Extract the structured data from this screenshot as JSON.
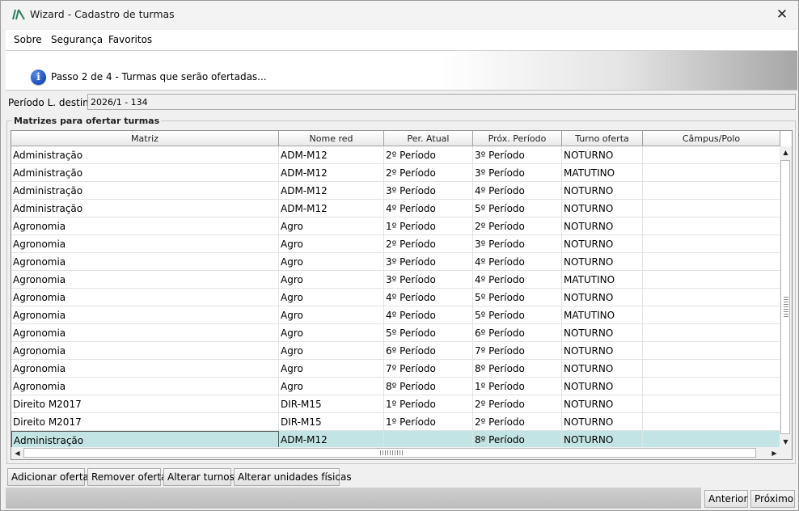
{
  "window": {
    "title": "Wizard - Cadastro de turmas",
    "close_symbol": "✕"
  },
  "menu": {
    "items": [
      "Sobre",
      "Segurança",
      "Favoritos"
    ]
  },
  "wizard": {
    "step_text": "Passo 2 de 4 - Turmas que serão ofertadas...",
    "info_icon_glyph": "i"
  },
  "period": {
    "label": "Período L. destino:",
    "value": "2026/1 - 134"
  },
  "group": {
    "title": "Matrizes para ofertar turmas"
  },
  "table": {
    "columns": [
      "Matriz",
      "Nome red",
      "Per. Atual",
      "Próx. Período",
      "Turno oferta",
      "Câmpus/Polo"
    ],
    "rows": [
      [
        "Administração",
        "ADM-M12",
        "2º Período",
        "3º Período",
        "NOTURNO",
        ""
      ],
      [
        "Administração",
        "ADM-M12",
        "2º Período",
        "3º Período",
        "MATUTINO",
        ""
      ],
      [
        "Administração",
        "ADM-M12",
        "3º Período",
        "4º Período",
        "NOTURNO",
        ""
      ],
      [
        "Administração",
        "ADM-M12",
        "4º Período",
        "5º Período",
        "NOTURNO",
        ""
      ],
      [
        "Agronomia",
        "Agro",
        "1º Período",
        "2º Período",
        "NOTURNO",
        ""
      ],
      [
        "Agronomia",
        "Agro",
        "2º Período",
        "3º Período",
        "NOTURNO",
        ""
      ],
      [
        "Agronomia",
        "Agro",
        "3º Período",
        "4º Período",
        "NOTURNO",
        ""
      ],
      [
        "Agronomia",
        "Agro",
        "3º Período",
        "4º Período",
        "MATUTINO",
        ""
      ],
      [
        "Agronomia",
        "Agro",
        "4º Período",
        "5º Período",
        "NOTURNO",
        ""
      ],
      [
        "Agronomia",
        "Agro",
        "4º Período",
        "5º Período",
        "MATUTINO",
        ""
      ],
      [
        "Agronomia",
        "Agro",
        "5º Período",
        "6º Período",
        "NOTURNO",
        ""
      ],
      [
        "Agronomia",
        "Agro",
        "6º Período",
        "7º Período",
        "NOTURNO",
        ""
      ],
      [
        "Agronomia",
        "Agro",
        "7º Período",
        "8º Período",
        "NOTURNO",
        ""
      ],
      [
        "Agronomia",
        "Agro",
        "8º Período",
        "1º Período",
        "NOTURNO",
        ""
      ],
      [
        "Direito M2017",
        "DIR-M15",
        "1º Período",
        "2º Período",
        "NOTURNO",
        ""
      ],
      [
        "Direito M2017",
        "DIR-M15",
        "1º Período",
        "2º Período",
        "NOTURNO",
        ""
      ],
      [
        "Administração",
        "ADM-M12",
        "",
        "8º Período",
        "NOTURNO",
        ""
      ]
    ],
    "selected_row": 16,
    "selection_color": "#c3e4e4"
  },
  "scroll": {
    "up": "▲",
    "down": "▼",
    "left": "◀",
    "right": "▶"
  },
  "actions": [
    "Adicionar oferta",
    "Remover oferta",
    "Alterar turnos",
    "Alterar unidades físicas"
  ],
  "nav": {
    "back": "Anterior",
    "next": "Próximo"
  },
  "colors": {
    "accent": "#1a4db8",
    "window_bg": "#f0f0f0"
  }
}
